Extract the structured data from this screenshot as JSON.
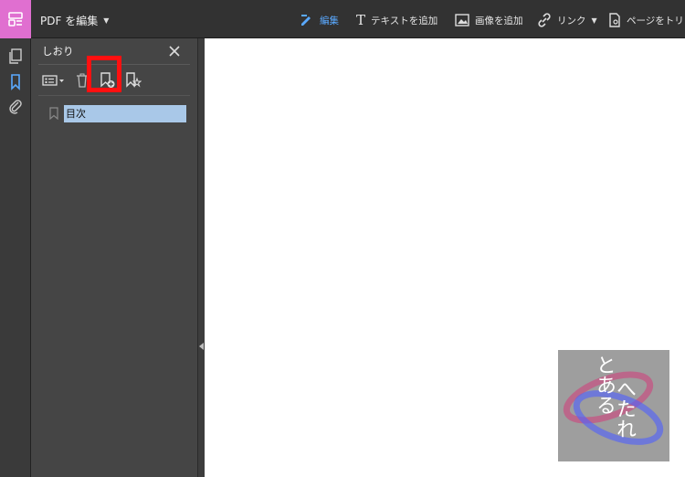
{
  "topbar": {
    "app_title": "PDF を編集",
    "tools": [
      {
        "label": "編集",
        "icon": "edit-icon",
        "active": true
      },
      {
        "label": "テキストを追加",
        "icon": "text-icon",
        "active": false
      },
      {
        "label": "画像を追加",
        "icon": "image-icon",
        "active": false
      },
      {
        "label": "リンク",
        "icon": "link-icon",
        "active": false
      },
      {
        "label": "ページをトリ",
        "icon": "crop-page-icon",
        "active": false
      }
    ]
  },
  "rail": {
    "items": [
      {
        "icon": "pages-icon",
        "selected": false
      },
      {
        "icon": "bookmark-icon",
        "selected": true
      },
      {
        "icon": "attachment-icon",
        "selected": false
      }
    ]
  },
  "bookmarks_panel": {
    "title": "しおり",
    "toolbar": [
      "options-menu-icon",
      "delete-icon",
      "new-bookmark-icon",
      "bookmark-star-icon"
    ],
    "items": [
      {
        "label": "目次",
        "selected": true
      }
    ]
  },
  "watermark": {
    "text_left": "とある",
    "text_right": "へたれ"
  },
  "colors": {
    "accent": "#5aa9ff",
    "app_icon_bg": "#e06fd0",
    "highlight": "#ff1010",
    "selection": "#a9c8e8"
  }
}
